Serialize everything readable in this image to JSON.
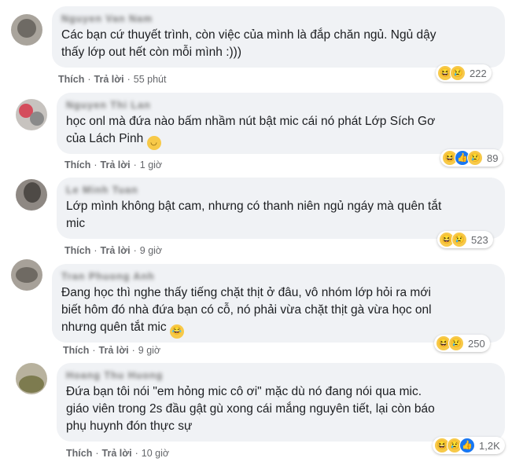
{
  "comments": [
    {
      "author": "Nguyen Van Nam",
      "text": "Các bạn cứ thuyết trình, còn việc của mình là đắp chăn ngủ. Ngủ dậy\nthấy lớp out hết còn mỗi mình :)))",
      "emoji": "",
      "like_label": "Thích",
      "reply_label": "Trả lời",
      "time": "55 phút",
      "reactions": [
        "haha-icon",
        "sad-icon"
      ],
      "reaction_count": "222"
    },
    {
      "author": "Nguyen Thi Lan",
      "text": "học onl mà đứa nào bấm nhầm nút bật mic cái nó phát Lớp Sích Gơ\ncủa Lách Pinh ",
      "emoji": "slightly-smiling-emoji",
      "like_label": "Thích",
      "reply_label": "Trả lời",
      "time": "1 giờ",
      "reactions": [
        "haha-icon",
        "like-icon",
        "sad-icon"
      ],
      "reaction_count": "89"
    },
    {
      "author": "Le Minh Tuan",
      "text": "Lớp mình không bật cam, nhưng có thanh niên ngủ ngáy mà quên tắt\nmic",
      "emoji": "",
      "like_label": "Thích",
      "reply_label": "Trả lời",
      "time": "9 giờ",
      "reactions": [
        "haha-icon",
        "sad-icon"
      ],
      "reaction_count": "523"
    },
    {
      "author": "Tran Phuong Anh",
      "text": "Đang học thì nghe thấy tiếng chặt thịt ở đâu, vô nhóm lớp hỏi ra mới\nbiết hôm đó nhà đứa bạn có cỗ, nó phải vừa chặt thịt gà vừa học onl\nnhưng quên tắt mic ",
      "emoji": "crying-laughing-emoji",
      "like_label": "Thích",
      "reply_label": "Trả lời",
      "time": "9 giờ",
      "reactions": [
        "haha-icon",
        "sad-icon"
      ],
      "reaction_count": "250"
    },
    {
      "author": "Hoang Thu Huong",
      "text": "Đứa bạn tôi nói \"em hỏng mic cô ơi\" mặc dù nó đang nói qua mic.\ngiáo viên trong 2s đầu gật gù xong cái mắng nguyên tiết, lại còn báo\nphụ huynh đón thực sự",
      "emoji": "",
      "like_label": "Thích",
      "reply_label": "Trả lời",
      "time": "10 giờ",
      "reactions": [
        "haha-icon",
        "sad-icon",
        "like-icon"
      ],
      "reaction_count": "1,2K"
    }
  ]
}
